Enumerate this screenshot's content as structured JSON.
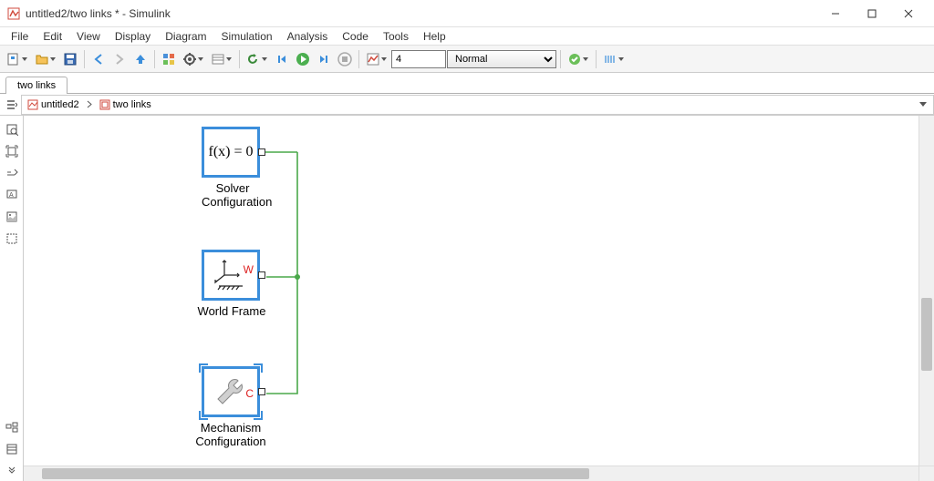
{
  "window": {
    "title": "untitled2/two links * - Simulink"
  },
  "menu": {
    "items": [
      "File",
      "Edit",
      "View",
      "Display",
      "Diagram",
      "Simulation",
      "Analysis",
      "Code",
      "Tools",
      "Help"
    ]
  },
  "toolbar": {
    "stop_time": "4",
    "sim_mode": "Normal"
  },
  "tab": {
    "label": "two links"
  },
  "breadcrumb": {
    "root": "untitled2",
    "child": "two links"
  },
  "blocks": {
    "solver": {
      "text": "f(x) = 0",
      "label": "Solver\nConfiguration"
    },
    "world": {
      "badge": "W",
      "label": "World Frame"
    },
    "mech": {
      "badge": "C",
      "label": "Mechanism\nConfiguration"
    }
  }
}
